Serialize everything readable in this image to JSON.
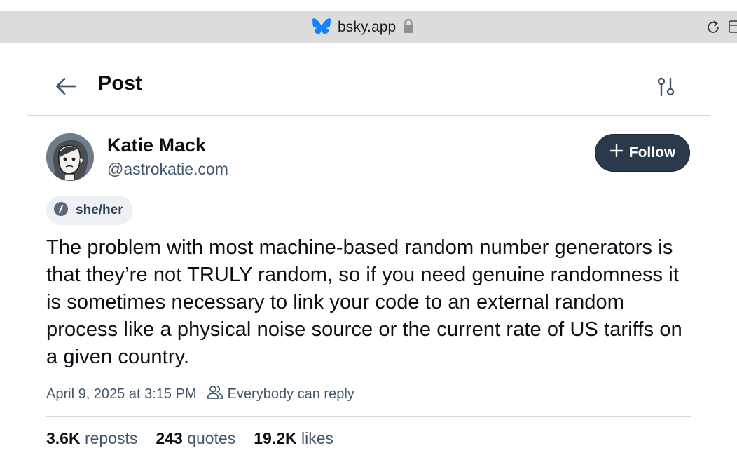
{
  "browser": {
    "url": "bsky.app",
    "lock_icon": "lock-icon",
    "site_icon": "butterfly-icon",
    "reload_icon": "reload-icon"
  },
  "header": {
    "title": "Post",
    "back_icon": "arrow-left-icon",
    "filter_icon": "sliders-icon"
  },
  "author": {
    "name": "Katie Mack",
    "handle": "@astrokatie.com",
    "pronouns": "she/her"
  },
  "follow_button": {
    "label": "Follow",
    "icon": "plus-icon"
  },
  "post": {
    "text": "The problem with most machine-based random number generators is that they’re not TRULY random, so if you need genuine randomness it is sometimes necessary to link your code to an external random process like a physical noise source or the current rate of US tariffs on a given country.",
    "timestamp": "April 9, 2025 at 3:15 PM",
    "reply_setting": "Everybody can reply"
  },
  "stats": {
    "reposts_count": "3.6K",
    "reposts_label": "reposts",
    "quotes_count": "243",
    "quotes_label": "quotes",
    "likes_count": "19.2K",
    "likes_label": "likes"
  },
  "colors": {
    "accent_dark": "#2a3a4b",
    "muted_text": "#42576c",
    "bluesky_blue": "#1185fe"
  }
}
